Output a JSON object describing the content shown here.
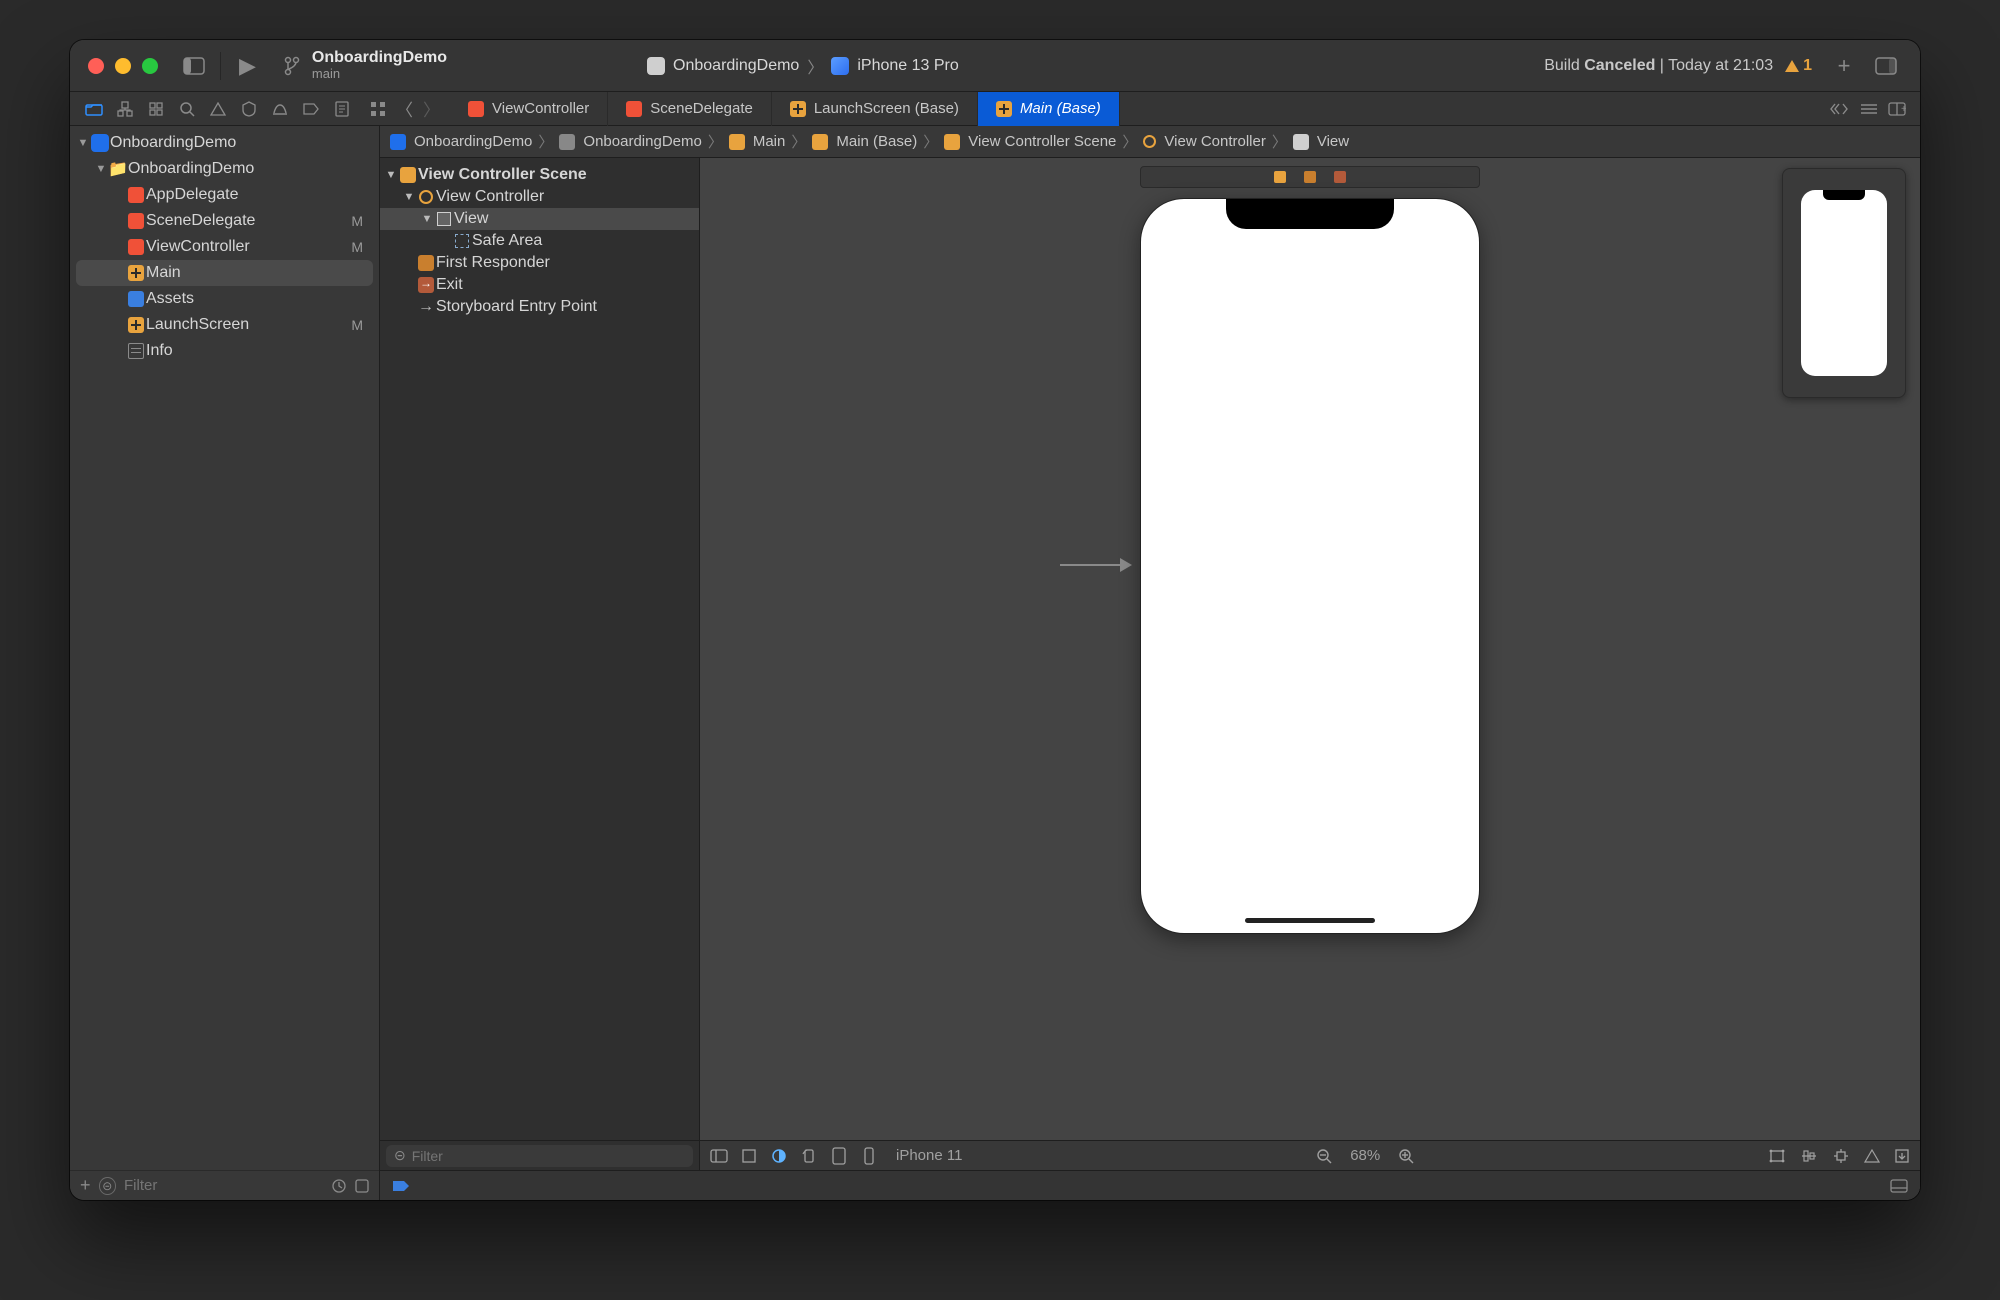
{
  "titlebar": {
    "project_name": "OnboardingDemo",
    "branch": "main",
    "scheme": "OnboardingDemo",
    "destination": "iPhone 13 Pro",
    "build_status_prefix": "Build ",
    "build_status_bold": "Canceled",
    "build_status_time": " | Today at 21:03",
    "warning_count": "1"
  },
  "tabs": [
    {
      "label": "ViewController",
      "icon": "swift"
    },
    {
      "label": "SceneDelegate",
      "icon": "swift"
    },
    {
      "label": "LaunchScreen (Base)",
      "icon": "ib"
    },
    {
      "label": "Main (Base)",
      "icon": "ib",
      "active": true
    }
  ],
  "navigator": {
    "root": "OnboardingDemo",
    "group": "OnboardingDemo",
    "items": [
      {
        "label": "AppDelegate",
        "icon": "swift",
        "mod": ""
      },
      {
        "label": "SceneDelegate",
        "icon": "swift",
        "mod": "M"
      },
      {
        "label": "ViewController",
        "icon": "swift",
        "mod": "M"
      },
      {
        "label": "Main",
        "icon": "ib",
        "mod": "",
        "selected": true
      },
      {
        "label": "Assets",
        "icon": "asset",
        "mod": ""
      },
      {
        "label": "LaunchScreen",
        "icon": "ib",
        "mod": "M"
      },
      {
        "label": "Info",
        "icon": "plist",
        "mod": ""
      }
    ],
    "filter_placeholder": "Filter"
  },
  "jumpbar": [
    "OnboardingDemo",
    "OnboardingDemo",
    "Main",
    "Main (Base)",
    "View Controller Scene",
    "View Controller",
    "View"
  ],
  "outline": {
    "scene": "View Controller Scene",
    "vc": "View Controller",
    "view": "View",
    "safe": "Safe Area",
    "first_responder": "First Responder",
    "exit": "Exit",
    "entry": "Storyboard Entry Point",
    "filter_placeholder": "Filter"
  },
  "canvasbar": {
    "device": "iPhone 11",
    "zoom": "68%"
  }
}
